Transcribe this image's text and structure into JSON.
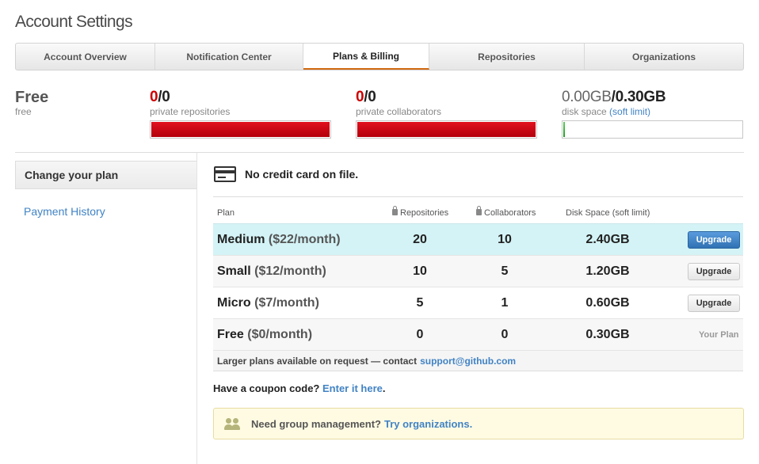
{
  "page": {
    "title": "Account Settings"
  },
  "tabs": [
    {
      "label": "Account Overview",
      "active": false
    },
    {
      "label": "Notification Center",
      "active": false
    },
    {
      "label": "Plans & Billing",
      "active": true
    },
    {
      "label": "Repositories",
      "active": false
    },
    {
      "label": "Organizations",
      "active": false
    }
  ],
  "summary": {
    "plan_name": "Free",
    "plan_sub": "free",
    "private_repos": {
      "used": "0",
      "sep_total": "/0",
      "label": "private repositories",
      "usage_fraction": 1.0
    },
    "private_collaborators": {
      "used": "0",
      "sep_total": "/0",
      "label": "private collaborators",
      "usage_fraction": 1.0
    },
    "disk_space": {
      "used": "0.00GB",
      "sep_total": "/0.30GB",
      "label": "disk space",
      "link": "(soft limit)",
      "usage_fraction": 0.01
    }
  },
  "sidebar": {
    "active_item": "Change your plan",
    "items": [
      "Payment History"
    ]
  },
  "billing": {
    "credit_card_text": "No credit card on file."
  },
  "plans_table": {
    "headers": {
      "plan": "Plan",
      "repos": "Repositories",
      "collaborators": "Collaborators",
      "disk": "Disk Space (soft limit)"
    },
    "rows": [
      {
        "name": "Medium",
        "price": "($22/month)",
        "repos": "20",
        "collaborators": "10",
        "disk": "2.40GB",
        "action": "Upgrade"
      },
      {
        "name": "Small",
        "price": "($12/month)",
        "repos": "10",
        "collaborators": "5",
        "disk": "1.20GB",
        "action": "Upgrade"
      },
      {
        "name": "Micro",
        "price": "($7/month)",
        "repos": "5",
        "collaborators": "1",
        "disk": "0.60GB",
        "action": "Upgrade"
      },
      {
        "name": "Free",
        "price": "($0/month)",
        "repos": "0",
        "collaborators": "0",
        "disk": "0.30GB",
        "action": "Your Plan"
      }
    ],
    "note_text": "Larger plans available on request — contact",
    "note_link": "support@github.com"
  },
  "coupon": {
    "text": "Have a coupon code?",
    "link": "Enter it here",
    "after": "."
  },
  "group_box": {
    "text": "Need group management?",
    "link": "Try organizations."
  },
  "colors": {
    "accent_tab": "#d26911",
    "link": "#4183c4",
    "danger": "#cc0000",
    "highlight_row": "#d4f3f6",
    "upgrade_primary": "#3072b3"
  }
}
